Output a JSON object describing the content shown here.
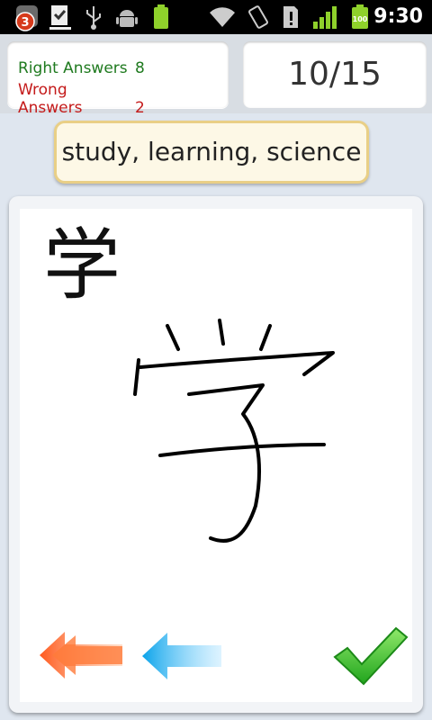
{
  "status_bar": {
    "notification_count": "3",
    "battery_level": "100",
    "time": "9:30"
  },
  "score": {
    "right_label": "Right Answers",
    "right_count": "8",
    "wrong_label": "Wrong Answers",
    "wrong_count": "2"
  },
  "progress": "10/15",
  "meaning": "study, learning, science",
  "character": "学",
  "colors": {
    "right": "#1f7a1f",
    "wrong": "#c41a1a",
    "pill_border": "#e9cf86"
  },
  "icons": {
    "fast_back": "double-left-arrow-icon",
    "back": "left-arrow-icon",
    "confirm": "checkmark-icon"
  }
}
